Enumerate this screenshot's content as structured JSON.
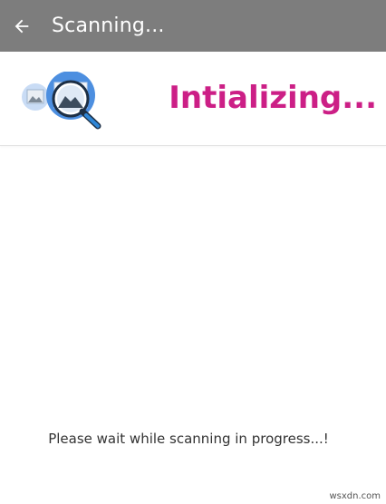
{
  "app_bar": {
    "title": "Scanning...",
    "back_icon": "arrow-back-icon",
    "background": "#7d7d7d"
  },
  "header": {
    "illustration_icon": "image-magnifier-icon",
    "status": "Intializing...",
    "status_color": "#cc1f86"
  },
  "message": "Please wait while scanning in progress...!",
  "watermark": "wsxdn.com"
}
